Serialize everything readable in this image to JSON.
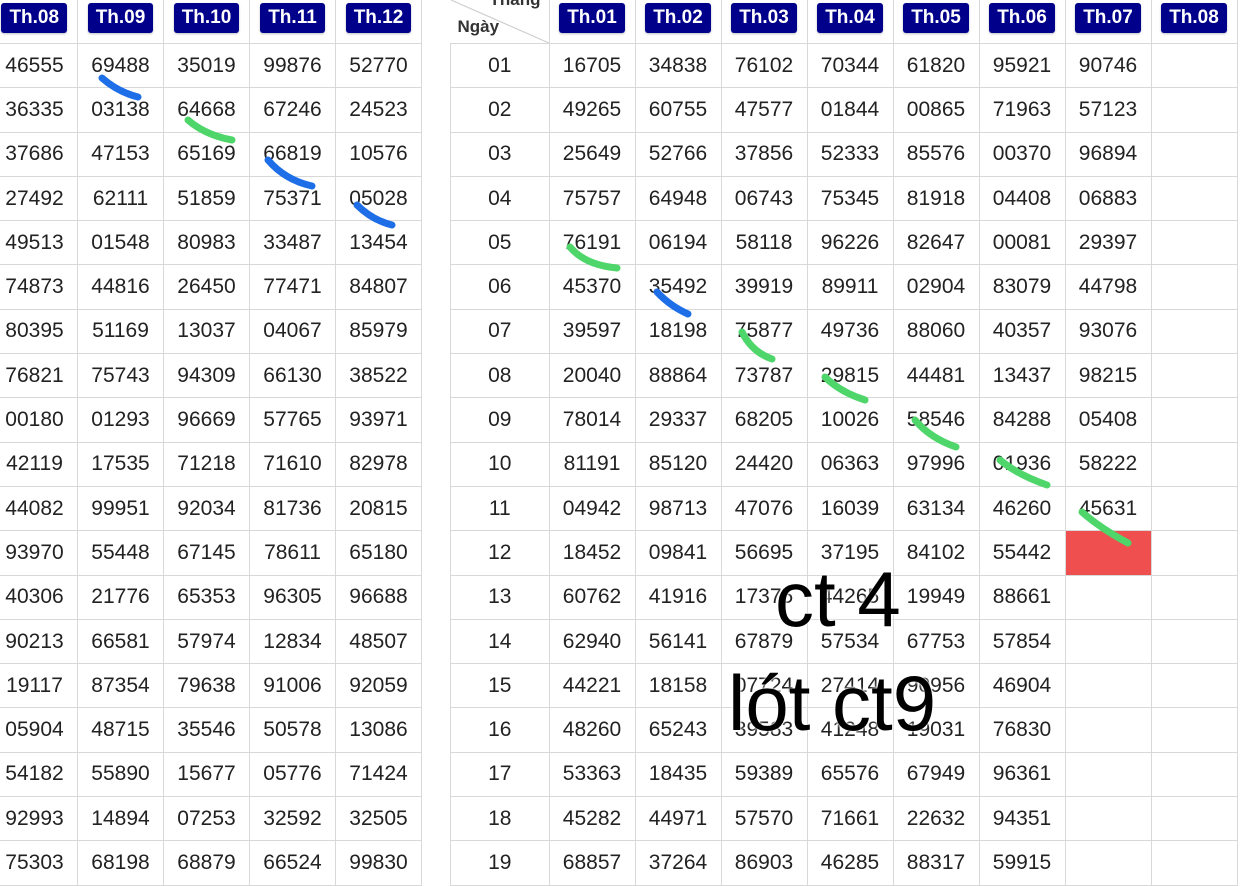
{
  "left_table": {
    "headers": [
      "Th.08",
      "Th.09",
      "Th.10",
      "Th.11",
      "Th.12"
    ],
    "rows": [
      [
        "46555",
        "69488",
        "35019",
        "99876",
        "52770"
      ],
      [
        "36335",
        "03138",
        "64668",
        "67246",
        "24523"
      ],
      [
        "37686",
        "47153",
        "65169",
        "66819",
        "10576"
      ],
      [
        "27492",
        "62111",
        "51859",
        "75371",
        "05028"
      ],
      [
        "49513",
        "01548",
        "80983",
        "33487",
        "13454"
      ],
      [
        "74873",
        "44816",
        "26450",
        "77471",
        "84807"
      ],
      [
        "80395",
        "51169",
        "13037",
        "04067",
        "85979"
      ],
      [
        "76821",
        "75743",
        "94309",
        "66130",
        "38522"
      ],
      [
        "00180",
        "01293",
        "96669",
        "57765",
        "93971"
      ],
      [
        "42119",
        "17535",
        "71218",
        "71610",
        "82978"
      ],
      [
        "44082",
        "99951",
        "92034",
        "81736",
        "20815"
      ],
      [
        "93970",
        "55448",
        "67145",
        "78611",
        "65180"
      ],
      [
        "40306",
        "21776",
        "65353",
        "96305",
        "96688"
      ],
      [
        "90213",
        "66581",
        "57974",
        "12834",
        "48507"
      ],
      [
        "19117",
        "87354",
        "79638",
        "91006",
        "92059"
      ],
      [
        "05904",
        "48715",
        "35546",
        "50578",
        "13086"
      ],
      [
        "54182",
        "55890",
        "15677",
        "05776",
        "71424"
      ],
      [
        "92993",
        "14894",
        "07253",
        "32592",
        "32505"
      ],
      [
        "75303",
        "68198",
        "68879",
        "66524",
        "99830"
      ]
    ]
  },
  "right_table": {
    "corner_top": "Tháng",
    "corner_bottom": "Ngày",
    "headers": [
      "Th.01",
      "Th.02",
      "Th.03",
      "Th.04",
      "Th.05",
      "Th.06",
      "Th.07",
      "Th.08"
    ],
    "rows": [
      {
        "day": "01",
        "values": [
          "16705",
          "34838",
          "76102",
          "70344",
          "61820",
          "95921",
          "90746",
          ""
        ]
      },
      {
        "day": "02",
        "values": [
          "49265",
          "60755",
          "47577",
          "01844",
          "00865",
          "71963",
          "57123",
          ""
        ]
      },
      {
        "day": "03",
        "values": [
          "25649",
          "52766",
          "37856",
          "52333",
          "85576",
          "00370",
          "96894",
          ""
        ]
      },
      {
        "day": "04",
        "values": [
          "75757",
          "64948",
          "06743",
          "75345",
          "81918",
          "04408",
          "06883",
          ""
        ]
      },
      {
        "day": "05",
        "values": [
          "76191",
          "06194",
          "58118",
          "96226",
          "82647",
          "00081",
          "29397",
          ""
        ]
      },
      {
        "day": "06",
        "values": [
          "45370",
          "35492",
          "39919",
          "89911",
          "02904",
          "83079",
          "44798",
          ""
        ]
      },
      {
        "day": "07",
        "values": [
          "39597",
          "18198",
          "75877",
          "49736",
          "88060",
          "40357",
          "93076",
          ""
        ]
      },
      {
        "day": "08",
        "values": [
          "20040",
          "88864",
          "73787",
          "29815",
          "44481",
          "13437",
          "98215",
          ""
        ]
      },
      {
        "day": "09",
        "values": [
          "78014",
          "29337",
          "68205",
          "10026",
          "58546",
          "84288",
          "05408",
          ""
        ]
      },
      {
        "day": "10",
        "values": [
          "81191",
          "85120",
          "24420",
          "06363",
          "97996",
          "01936",
          "58222",
          ""
        ]
      },
      {
        "day": "11",
        "values": [
          "04942",
          "98713",
          "47076",
          "16039",
          "63134",
          "46260",
          "45631",
          ""
        ]
      },
      {
        "day": "12",
        "values": [
          "18452",
          "09841",
          "56695",
          "37195",
          "84102",
          "55442",
          "",
          ""
        ]
      },
      {
        "day": "13",
        "values": [
          "60762",
          "41916",
          "17375",
          "44265",
          "19949",
          "88661",
          "",
          ""
        ]
      },
      {
        "day": "14",
        "values": [
          "62940",
          "56141",
          "67879",
          "57534",
          "67753",
          "57854",
          "",
          ""
        ]
      },
      {
        "day": "15",
        "values": [
          "44221",
          "18158",
          "07724",
          "27414",
          "90956",
          "46904",
          "",
          ""
        ]
      },
      {
        "day": "16",
        "values": [
          "48260",
          "65243",
          "39583",
          "41248",
          "19031",
          "76830",
          "",
          ""
        ]
      },
      {
        "day": "17",
        "values": [
          "53363",
          "18435",
          "59389",
          "65576",
          "67949",
          "96361",
          "",
          ""
        ]
      },
      {
        "day": "18",
        "values": [
          "45282",
          "44971",
          "57570",
          "71661",
          "22632",
          "94351",
          "",
          ""
        ]
      },
      {
        "day": "19",
        "values": [
          "68857",
          "37264",
          "86903",
          "46285",
          "88317",
          "59915",
          "",
          ""
        ]
      }
    ],
    "highlight": {
      "day": "12",
      "column": "Th.07",
      "color": "#ef4f4f"
    }
  },
  "annotations": {
    "line1": "ct 4",
    "line2": "lót ct9"
  },
  "colors": {
    "header_bg": "#00008b",
    "stroke_blue": "#1e6ee8",
    "stroke_green": "#4fd66a"
  }
}
